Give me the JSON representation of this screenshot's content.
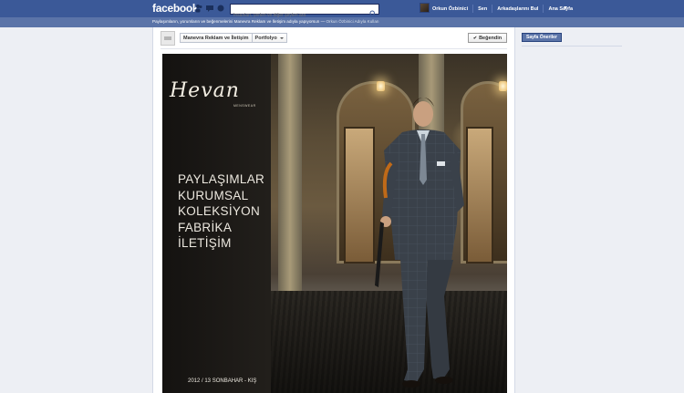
{
  "topbar": {
    "logo": "facebook",
    "search_placeholder": "İnsanları, yerleri ve diğer şeyleri ara",
    "user_name": "Orkun Özbinici",
    "nav": [
      "Orkun Özbinici",
      "Sen",
      "Arkadaşlarını Bul",
      "Ana Sayfa"
    ]
  },
  "subbar": {
    "text": "Paylaşımların, yorumların ve beğenmelerini Manevra Reklam ve İletişim adıyla yapıyorsun — ",
    "link": "Orkun Özbinici Adıyla Kullan"
  },
  "page": {
    "breadcrumb": [
      "Manevra Reklam ve İletişim",
      "Portfolyo"
    ],
    "like_label": "Beğendin"
  },
  "cover": {
    "brand": "Hevan",
    "brand_sub": "MENSWEAR",
    "menu": [
      "PAYLAŞIMLAR",
      "KURUMSAL",
      "KOLEKSİYON",
      "FABRİKA",
      "İLETİŞİM"
    ],
    "season": "2012 / 13 SONBAHAR - KIŞ"
  },
  "sidebar": {
    "button": "Sayfa Öneriler"
  }
}
